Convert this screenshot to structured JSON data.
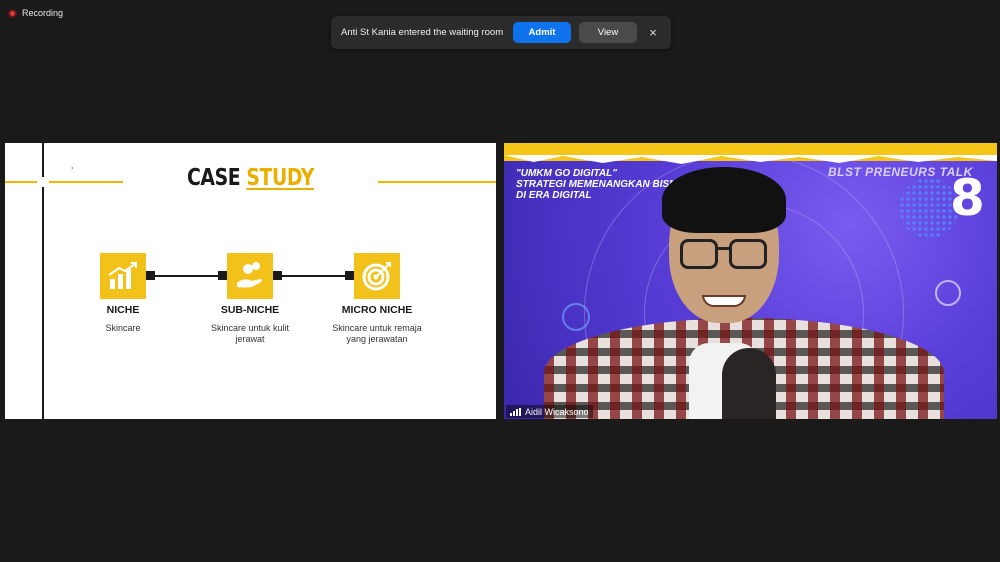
{
  "recording": {
    "label": "Recording"
  },
  "notification": {
    "message": "Anti St Kania entered the waiting room",
    "admit_label": "Admit",
    "view_label": "View",
    "close_icon": "×"
  },
  "slide": {
    "title_part1": "CASE ",
    "title_part2": "STUDY",
    "tick_mark": "›",
    "items": [
      {
        "icon": "chart-growth-icon",
        "title": "NICHE",
        "desc": "Skincare"
      },
      {
        "icon": "hand-coins-icon",
        "title": "SUB-NICHE",
        "desc": "Skincare untuk kulit jerawat"
      },
      {
        "icon": "target-icon",
        "title": "MICRO NICHE",
        "desc": "Skincare untuk remaja yang jerawatan"
      }
    ]
  },
  "video": {
    "banner_line1": "\"UMKM GO DIGITAL\"",
    "banner_line2": "STRATEGI MEMENANGKAN BISNIS",
    "banner_line3": "DI ERA DIGITAL",
    "banner_right": "BLST PRENEURS TALK",
    "episode": "8",
    "participant_name": "Aidil Wicaksono"
  },
  "colors": {
    "accent_yellow": "#f2c21b",
    "admit_blue": "#0e72ed",
    "background": "#1a1a1a",
    "video_purple": "#5a3fd9"
  }
}
